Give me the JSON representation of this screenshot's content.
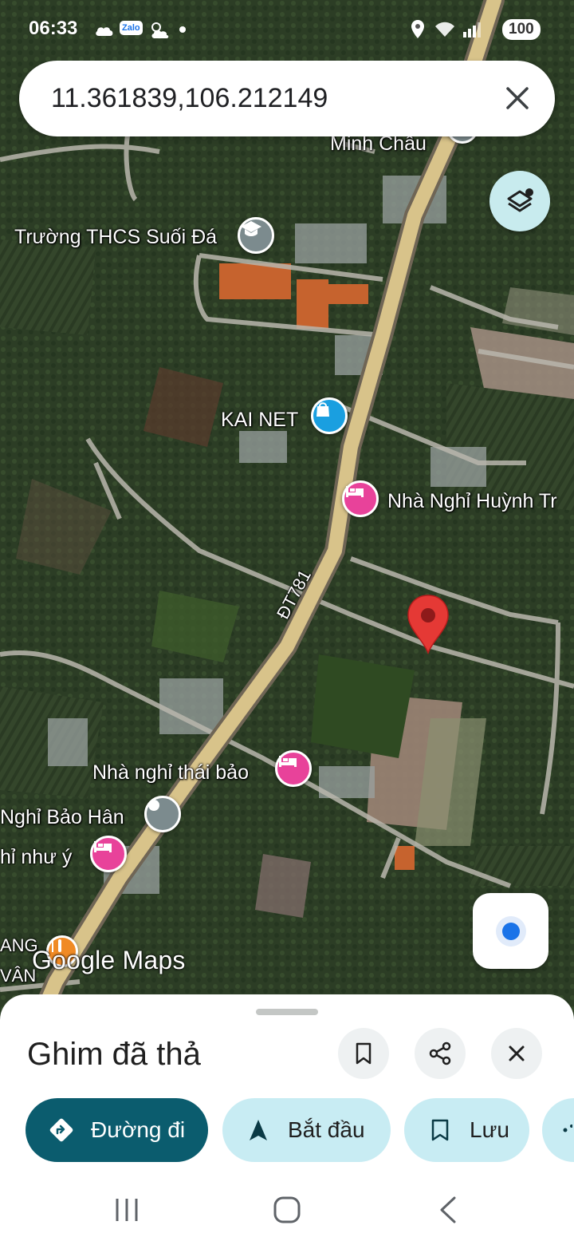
{
  "status_bar": {
    "time": "06:33",
    "app_icon_zalo": "Zalo",
    "battery": "100"
  },
  "search": {
    "query": "11.361839,106.212149"
  },
  "map": {
    "labels": {
      "minh_chau": "Minh Châu",
      "truong_thcs": "Trường THCS Suối Đá",
      "kai_net": "KAI NET",
      "nha_nghi_huynh": "Nhà Nghỉ Huỳnh Tr",
      "road": "ĐT781",
      "nha_nghi_thai_bao": "Nhà nghỉ thái bảo",
      "nghi_bao_han": "Nghỉ Bảo Hân",
      "nghi_nhu_y": "hỉ như ý",
      "ang": "ANG",
      "van": "VÂN"
    },
    "logo_text": "Google Maps"
  },
  "sheet": {
    "title": "Ghim đã thả",
    "chips": {
      "directions": "Đường đi",
      "start": "Bắt đầu",
      "save": "Lưu"
    }
  },
  "colors": {
    "primary_chip": "#0b5c6e",
    "secondary_chip": "#c8ecf3",
    "pin": "#e53935",
    "road": "#d8c38a",
    "hotel_poi": "#e8429a",
    "shop_poi": "#1a9fe0"
  }
}
